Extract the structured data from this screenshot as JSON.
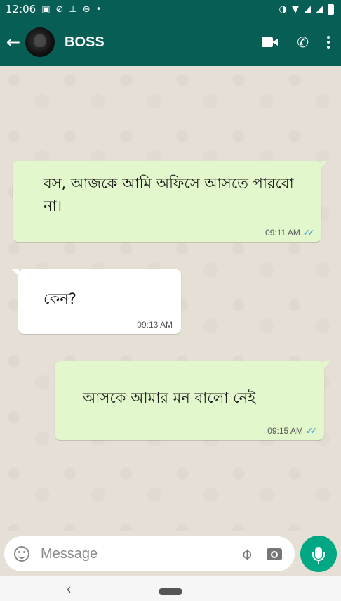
{
  "status_bar": {
    "time": "12:06"
  },
  "header": {
    "contact_name": "BOSS"
  },
  "messages": [
    {
      "direction": "outgoing",
      "text": "বস, আজকে আমি অফিসে আসতে পারবো না।",
      "time": "09:11 AM",
      "read": true
    },
    {
      "direction": "incoming",
      "text": "কেন?",
      "time": "09:13 AM"
    },
    {
      "direction": "outgoing",
      "text": "আসকে আমার মন বালো নেই",
      "time": "09:15 AM",
      "read": true
    }
  ],
  "input": {
    "placeholder": "Message"
  },
  "colors": {
    "header": "#075e54",
    "outgoing_bubble": "#e2f7cb",
    "incoming_bubble": "#ffffff",
    "mic_button": "#00a884",
    "read_ticks": "#4fa6e0"
  },
  "icons": [
    "back-arrow-icon",
    "video-call-icon",
    "phone-icon",
    "menu-dots-icon",
    "emoji-icon",
    "attach-icon",
    "camera-icon",
    "mic-icon"
  ]
}
